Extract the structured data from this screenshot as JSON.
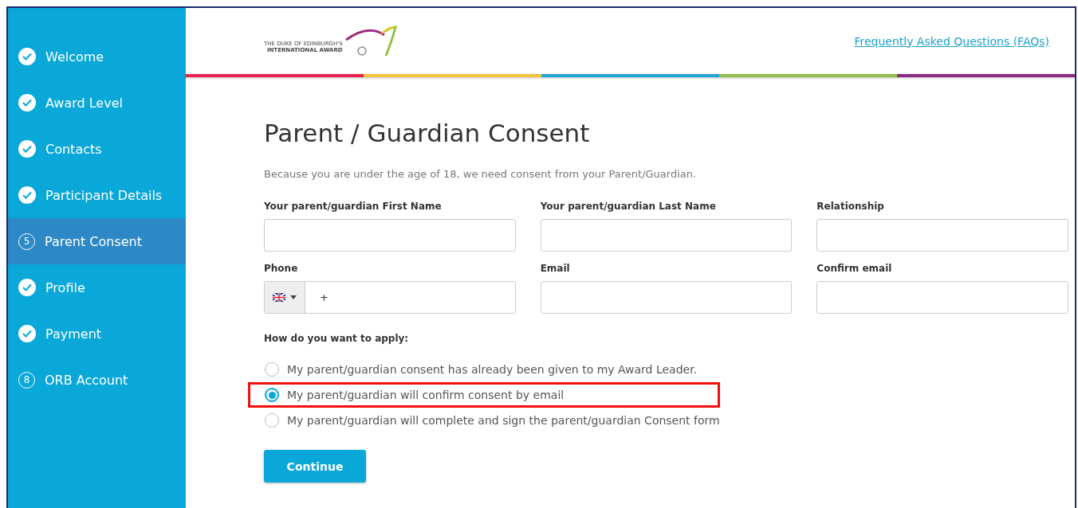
{
  "steps": [
    {
      "label": "Welcome",
      "kind": "done",
      "selected": false
    },
    {
      "label": "Award Level",
      "kind": "done",
      "selected": false
    },
    {
      "label": "Contacts",
      "kind": "done",
      "selected": false
    },
    {
      "label": "Participant Details",
      "kind": "done",
      "selected": false
    },
    {
      "label": "Parent Consent",
      "kind": "number",
      "number": "5",
      "selected": true
    },
    {
      "label": "Profile",
      "kind": "done",
      "selected": false
    },
    {
      "label": "Payment",
      "kind": "done",
      "selected": false
    },
    {
      "label": "ORB Account",
      "kind": "number",
      "number": "8",
      "selected": false
    }
  ],
  "header": {
    "logo_lines": [
      "THE DUKE OF EDINBURGH'S",
      "INTERNATIONAL AWARD"
    ],
    "faq_link": "Frequently Asked Questions (FAQs)"
  },
  "title": "Parent / Guardian Consent",
  "intro": "Because you are under the age of 18, we need consent from your Parent/Guardian.",
  "fields": [
    {
      "label": "Your parent/guardian First Name",
      "kind": "text"
    },
    {
      "label": "Your parent/guardian Last Name",
      "kind": "text"
    },
    {
      "label": "Relationship",
      "kind": "text"
    },
    {
      "label": "Phone",
      "kind": "phone",
      "value": "+"
    },
    {
      "label": "Email",
      "kind": "text"
    },
    {
      "label": "Confirm email",
      "kind": "text"
    }
  ],
  "apply_label": "How do you want to apply:",
  "options": [
    {
      "label": "My parent/guardian consent has already been given to my Award Leader.",
      "selected": false,
      "highlighted": false
    },
    {
      "label": "My parent/guardian will confirm consent by email",
      "selected": true,
      "highlighted": true
    },
    {
      "label": "My parent/guardian will complete and sign the parent/guardian Consent form",
      "selected": false,
      "highlighted": false
    }
  ],
  "continue_button": "Continue"
}
